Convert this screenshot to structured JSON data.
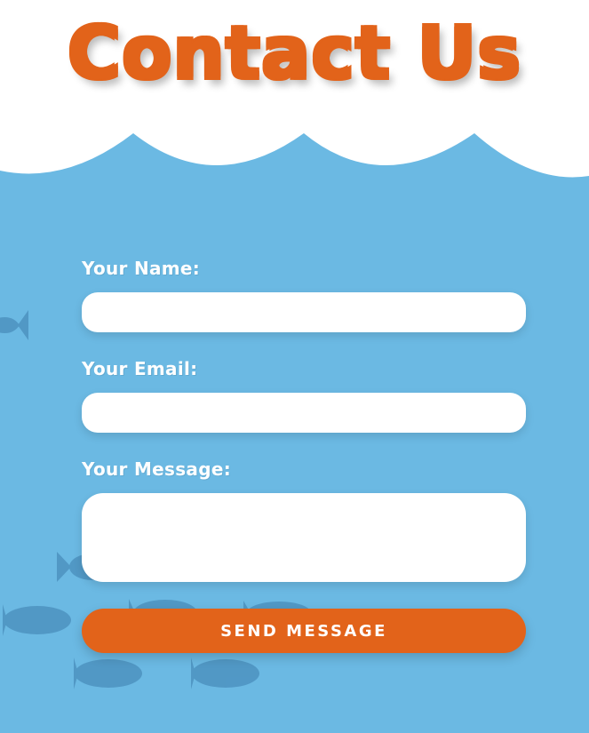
{
  "header": {
    "title": "Contact Us"
  },
  "form": {
    "name_label": "Your Name:",
    "email_label": "Your Email:",
    "message_label": "Your Message:",
    "name_value": "",
    "email_value": "",
    "message_value": "",
    "send_label": "SEND MESSAGE"
  },
  "decorations": {
    "fish_icon": "fish-icon",
    "wave_icon": "cloud-wave"
  },
  "colors": {
    "accent": "#e2631a",
    "sea": "#6bb9e3",
    "fish": "#4f95c2",
    "background": "#ffffff"
  }
}
